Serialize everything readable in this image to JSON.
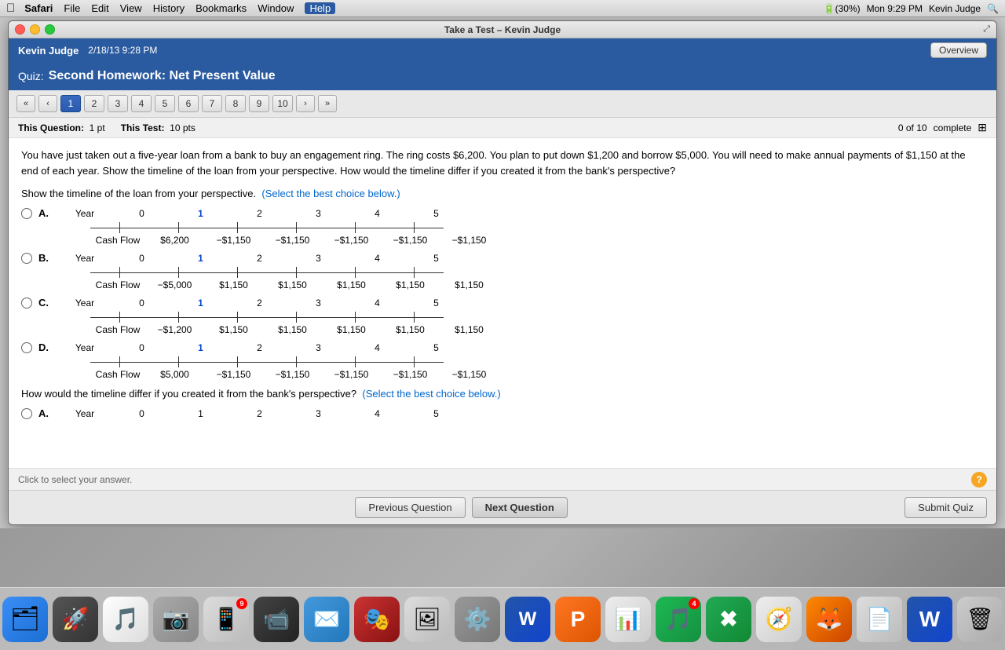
{
  "menubar": {
    "apple": "&#63743;",
    "items": [
      "Safari",
      "File",
      "Edit",
      "View",
      "History",
      "Bookmarks",
      "Window",
      "Help"
    ],
    "right": "Mon 9:29 PM  Kevin Judge"
  },
  "window": {
    "title": "Take a Test – Kevin Judge",
    "user": "Kevin Judge",
    "date": "2/18/13 9:28 PM",
    "overview_btn": "Overview"
  },
  "quiz": {
    "label": "Quiz:",
    "name": "Second Homework: Net Present Value"
  },
  "nav": {
    "prev_prev": "«",
    "prev": "‹",
    "next": "›",
    "next_next": "»",
    "pages": [
      "1",
      "2",
      "3",
      "4",
      "5",
      "6",
      "7",
      "8",
      "9",
      "10"
    ]
  },
  "status": {
    "question_label": "This Question:",
    "question_pts": "1 pt",
    "test_label": "This Test:",
    "test_pts": "10 pts",
    "progress": "0 of 10",
    "complete": "complete"
  },
  "question": {
    "text": "You have just taken out a five-year loan from a bank to buy an engagement ring. The ring costs $6,200. You plan to put down $1,200 and borrow $5,000. You will need to make annual payments of $1,150 at the end of each year. Show the timeline of the loan from your perspective. How would the timeline differ if you created it from the bank's perspective?",
    "part1": "Show the timeline of the loan from your perspective.",
    "select_text": "(Select the best choice below.)",
    "part2": "How would the timeline differ if you created it from the bank's perspective?",
    "select_text2": "(Select the best choice below.)"
  },
  "options": [
    {
      "id": "A",
      "years": [
        "0",
        "1",
        "2",
        "3",
        "4",
        "5"
      ],
      "cashflows": [
        "$6,200",
        "−$1,150",
        "−$1,150",
        "−$1,150",
        "−$1,150",
        "−$1,150"
      ],
      "bold_year": "1"
    },
    {
      "id": "B",
      "years": [
        "0",
        "1",
        "2",
        "3",
        "4",
        "5"
      ],
      "cashflows": [
        "−$5,000",
        "$1,150",
        "$1,150",
        "$1,150",
        "$1,150",
        "$1,150"
      ],
      "bold_year": "1"
    },
    {
      "id": "C",
      "years": [
        "0",
        "1",
        "2",
        "3",
        "4",
        "5"
      ],
      "cashflows": [
        "−$1,200",
        "$1,150",
        "$1,150",
        "$1,150",
        "$1,150",
        "$1,150"
      ],
      "bold_year": "1"
    },
    {
      "id": "D",
      "years": [
        "0",
        "1",
        "2",
        "3",
        "4",
        "5"
      ],
      "cashflows": [
        "$5,000",
        "−$1,150",
        "−$1,150",
        "−$1,150",
        "−$1,150",
        "−$1,150"
      ],
      "bold_year": "1"
    }
  ],
  "option2_A": {
    "id": "A",
    "years": [
      "0",
      "1",
      "2",
      "3",
      "4",
      "5"
    ]
  },
  "answer_bar": {
    "text": "Click to select your answer."
  },
  "buttons": {
    "previous": "Previous Question",
    "next": "Next Question",
    "submit": "Submit Quiz"
  },
  "dock_items": [
    "🔵",
    "🚀",
    "🎵",
    "📷",
    "📱",
    "📬",
    "🎭",
    "📸",
    "⚙️",
    "W",
    "P",
    "📊",
    "🎵",
    "✖",
    "🌐",
    "🦊",
    "📄",
    "W",
    "🗑"
  ],
  "colors": {
    "header_bg": "#2a5a9f",
    "active_nav": "#2a5aaf",
    "help_btn": "#f5a623"
  }
}
